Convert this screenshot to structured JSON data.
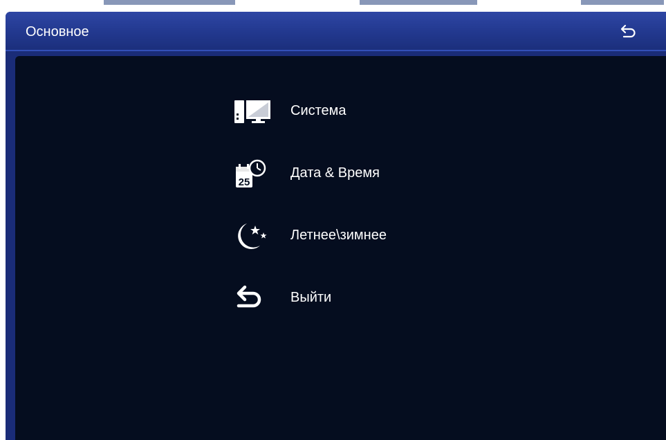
{
  "window": {
    "title": "Основное"
  },
  "menu": {
    "items": [
      {
        "label": "Система",
        "icon": "computer-monitor-icon"
      },
      {
        "label": "Дата & Время",
        "icon": "calendar-clock-icon"
      },
      {
        "label": "Летнее\\зимнее",
        "icon": "moon-stars-icon"
      },
      {
        "label": "Выйти",
        "icon": "exit-arrow-icon"
      }
    ]
  },
  "colors": {
    "titlebar": "#22388e",
    "frame": "#1a2c78",
    "content_bg": "#050d1f",
    "text": "#ffffff",
    "header_strip_text": "#3a55d8"
  }
}
